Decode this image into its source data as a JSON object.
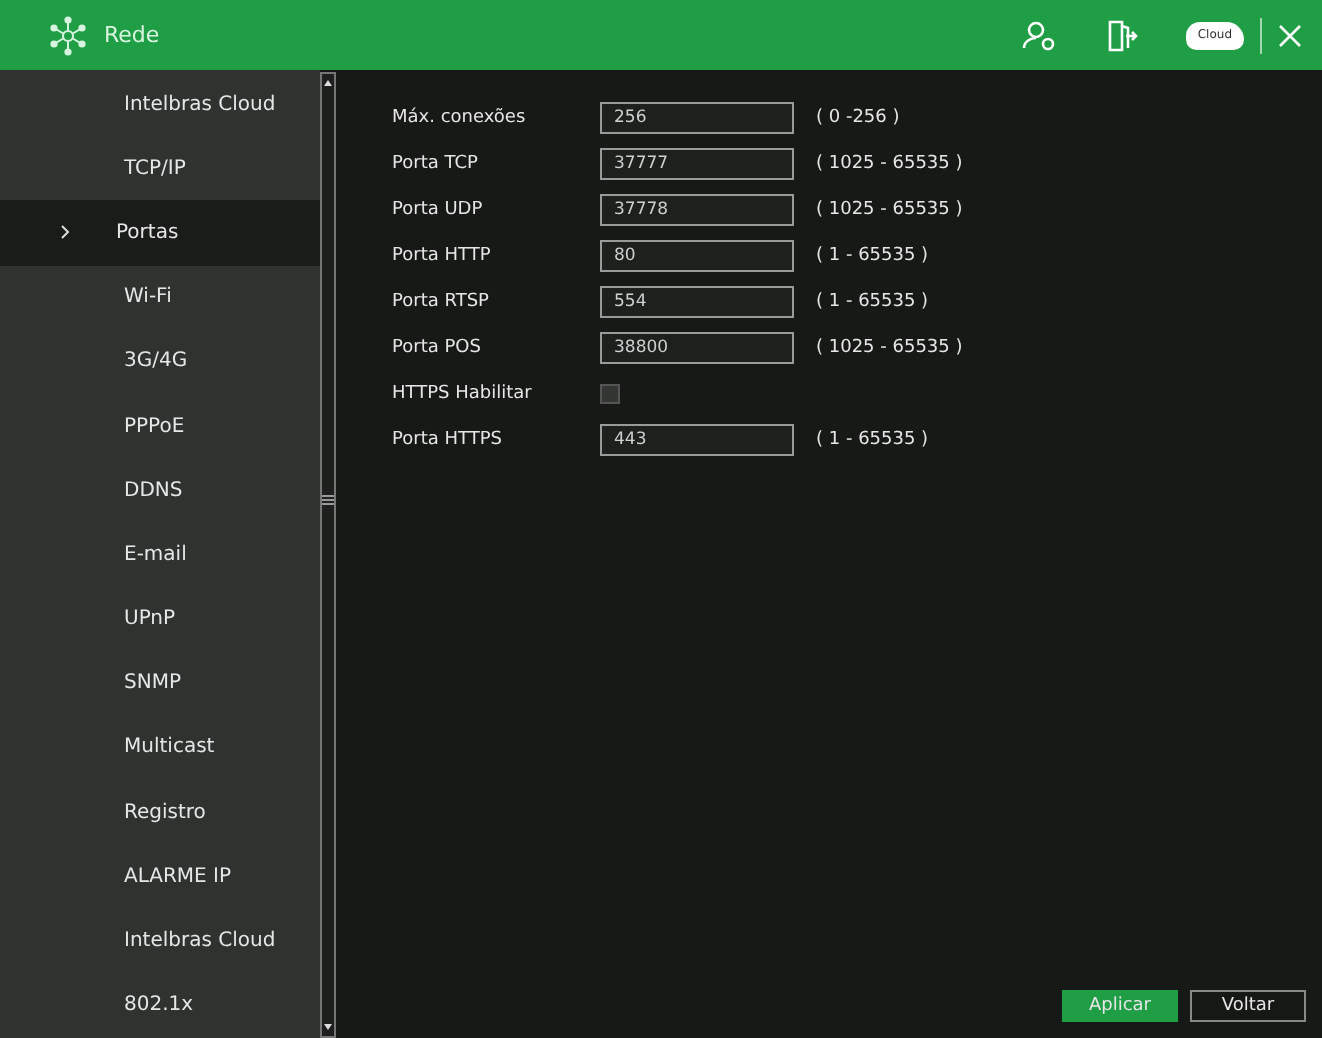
{
  "window": {
    "title": "Rede"
  },
  "sidebar": {
    "items": [
      {
        "label": "Intelbras Cloud",
        "selected": false
      },
      {
        "label": "TCP/IP",
        "selected": false
      },
      {
        "label": "Portas",
        "selected": true
      },
      {
        "label": "Wi-Fi",
        "selected": false
      },
      {
        "label": "3G/4G",
        "selected": false
      },
      {
        "label": "PPPoE",
        "selected": false
      },
      {
        "label": "DDNS",
        "selected": false
      },
      {
        "label": "E-mail",
        "selected": false
      },
      {
        "label": "UPnP",
        "selected": false
      },
      {
        "label": "SNMP",
        "selected": false
      },
      {
        "label": "Multicast",
        "selected": false
      },
      {
        "label": "Registro",
        "selected": false
      },
      {
        "label": "ALARME IP",
        "selected": false
      },
      {
        "label": "Intelbras Cloud",
        "selected": false
      },
      {
        "label": "802.1x",
        "selected": false
      }
    ]
  },
  "form": [
    {
      "kind": "input",
      "label": "Máx. conexões",
      "value": "256",
      "range": "( 0 -256 )"
    },
    {
      "kind": "input",
      "label": "Porta TCP",
      "value": "37777",
      "range": "( 1025 - 65535 )"
    },
    {
      "kind": "input",
      "label": "Porta UDP",
      "value": "37778",
      "range": "( 1025 - 65535 )"
    },
    {
      "kind": "input",
      "label": "Porta HTTP",
      "value": "80",
      "range": "( 1 - 65535 )"
    },
    {
      "kind": "input",
      "label": "Porta RTSP",
      "value": "554",
      "range": "( 1 - 65535 )"
    },
    {
      "kind": "input",
      "label": "Porta POS",
      "value": "38800",
      "range": "( 1025 - 65535 )"
    },
    {
      "kind": "checkbox",
      "label": "HTTPS Habilitar",
      "checked": false
    },
    {
      "kind": "input",
      "label": "Porta HTTPS",
      "value": "443",
      "range": "( 1 - 65535 )"
    }
  ],
  "buttons": [
    {
      "label": "Aplicar",
      "primary": true
    },
    {
      "label": "Voltar",
      "primary": false
    }
  ],
  "cloud_badge": "Cloud"
}
